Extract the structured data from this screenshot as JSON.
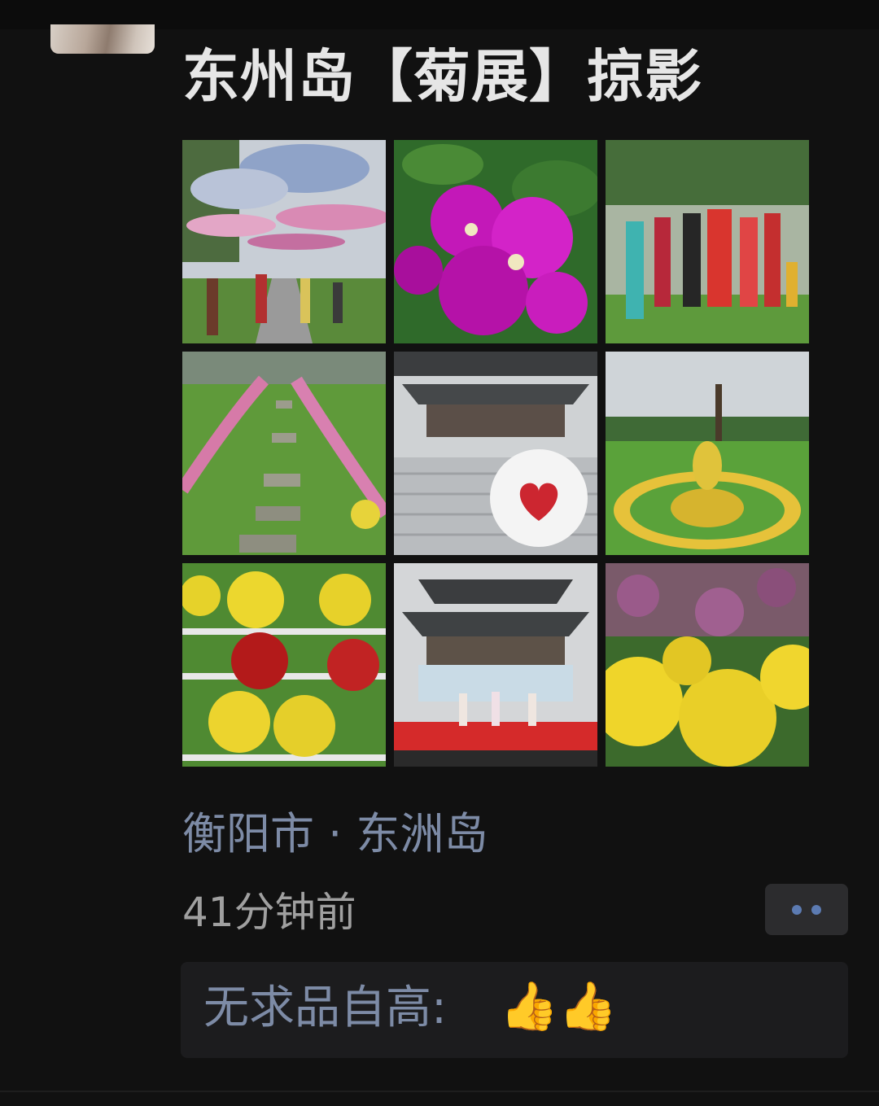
{
  "post": {
    "title": "东州岛【菊展】掠影",
    "photos": [
      {
        "name": "umbrella-walkway-photo"
      },
      {
        "name": "bougainvillea-closeup-photo"
      },
      {
        "name": "dancing-crowd-photo"
      },
      {
        "name": "stepping-stone-path-photo"
      },
      {
        "name": "pavilion-stairs-photo"
      },
      {
        "name": "flower-circle-garden-photo"
      },
      {
        "name": "potted-chrysanthemum-rack-photo"
      },
      {
        "name": "pavilion-stage-performance-photo"
      },
      {
        "name": "yellow-chrysanthemum-field-photo"
      }
    ],
    "location": "衡阳市 · 东洲岛",
    "timestamp": "41分钟前"
  },
  "comment": {
    "user": "无求品自高:",
    "text": "👍👍"
  },
  "colors": {
    "background": "#111111",
    "link": "#7d8ba6",
    "title": "#e6e6e6",
    "more_dots": "#5c7bb2"
  }
}
